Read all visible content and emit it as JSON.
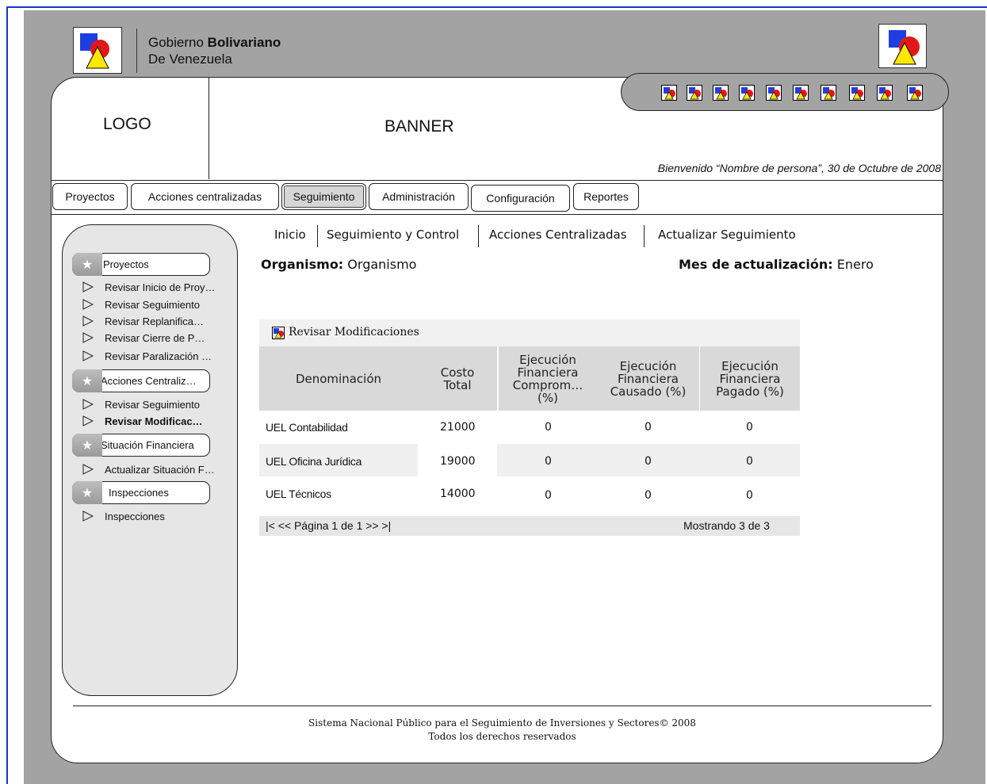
{
  "government": {
    "prefix": "Gobierno",
    "bold": "Bolivariano",
    "line2": "De Venezuela"
  },
  "header": {
    "logo_text": "LOGO",
    "banner_text": "BANNER",
    "welcome": "Bienvenido “Nombre de persona”, 30 de Octubre de 2008"
  },
  "nav": {
    "tabs": [
      {
        "label": "Proyectos"
      },
      {
        "label": "Acciones centralizadas"
      },
      {
        "label": "Seguimiento"
      },
      {
        "label": "Administración"
      },
      {
        "label": "Configuración"
      },
      {
        "label": "Reportes"
      }
    ],
    "active": "Seguimiento"
  },
  "sidebar": {
    "sections": [
      {
        "label": "Proyectos",
        "items": [
          "Revisar Inicio de Proy…",
          "Revisar Seguimiento",
          "Revisar Replanifica…",
          "Revisar Cierre de P…",
          "Revisar Paralización …"
        ]
      },
      {
        "label": "Acciones Centraliz…",
        "items": [
          "Revisar Seguimiento",
          "Revisar Modificac…"
        ]
      },
      {
        "label": "Situación Financiera",
        "items": [
          "Actualizar Situación F…"
        ]
      },
      {
        "label": "Inspecciones",
        "items": [
          "Inspecciones"
        ]
      }
    ]
  },
  "breadcrumb": [
    "Inicio",
    "Seguimiento y Control",
    "Acciones Centralizadas",
    "Actualizar Seguimiento"
  ],
  "info": {
    "organismo_label": "Organismo:",
    "organismo_value": "Organismo",
    "mes_label": "Mes de actualización:",
    "mes_value": "Enero"
  },
  "grid": {
    "title": "Revisar Modificaciones",
    "columns": [
      "Denominación",
      "Costo Total",
      "Ejecución Financiera Comprom… (%)",
      "Ejecución Financiera Causado (%)",
      "Ejecución Financiera Pagado (%)"
    ],
    "rows": [
      [
        "UEL Contabilidad",
        "21000",
        "0",
        "0",
        "0"
      ],
      [
        "UEL Oficina Jurídica",
        "19000",
        "0",
        "0",
        "0"
      ],
      [
        "UEL Técnicos",
        "14000",
        "0",
        "0",
        "0"
      ]
    ],
    "pager": "|<  << Página 1 de 1 >>  >|",
    "showing": "Mostrando 3 de 3"
  },
  "footer": {
    "line1": "Sistema Nacional Público para el Seguimiento de Inversiones y Sectores© 2008",
    "line2": "Todos los derechos reservados"
  },
  "colors": {
    "frame_blue": "#1a33cc",
    "gray_bg": "#a3a3a3",
    "header_cell": "#d9d9d9"
  }
}
